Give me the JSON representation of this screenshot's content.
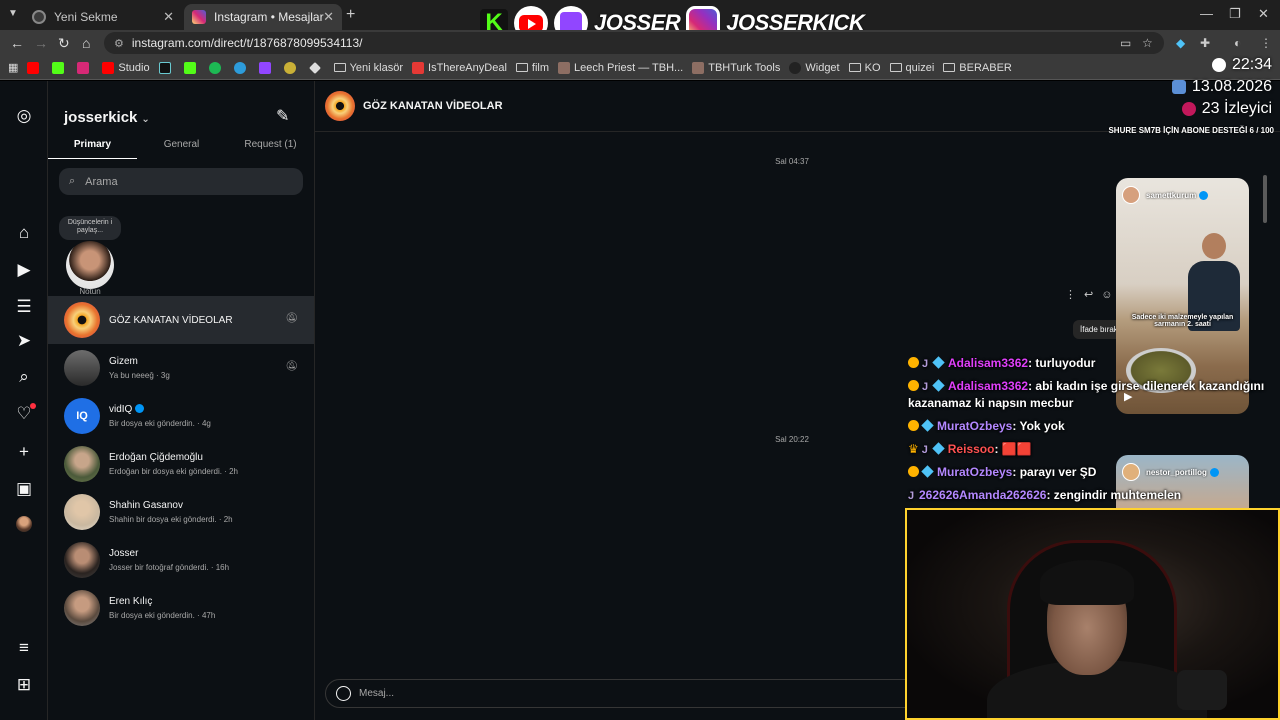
{
  "browser": {
    "tabs": [
      {
        "label": "Yeni Sekme",
        "active": false,
        "favicon_color": "#3b3b3b"
      },
      {
        "label": "Instagram • Mesajlar",
        "active": true,
        "favicon_color": "#e1306c"
      }
    ],
    "url": "instagram.com/direct/t/1876878099534113/",
    "bookmarks": [
      "Studio",
      "Yeni klasör",
      "IsThereAnyDeal",
      "film",
      "Leech Priest — TBH...",
      "TBHTurk Tools",
      "Widget",
      "KO",
      "quizei",
      "BERABER"
    ]
  },
  "stream_banner": {
    "name1": "JOSSER",
    "name2": "JOSSERKICK"
  },
  "overlay": {
    "time": "22:34",
    "date": "13.08.2026",
    "viewers": "23 İzleyici",
    "sub_goal": "SHURE SM7B İÇİN ABONE DESTEĞİ 6 / 100"
  },
  "instagram": {
    "username": "josserkick",
    "tabs": [
      "Primary",
      "General",
      "Request (1)"
    ],
    "search_placeholder": "Arama",
    "note_bubble": "Düşüncelerin i paylaş...",
    "note_label": "Notun",
    "conversations": [
      {
        "name": "GÖZ KANATAN VİDEOLAR",
        "sub": "",
        "muted": true,
        "selected": true
      },
      {
        "name": "Gizem",
        "sub": "Ya bu neeeğ · 3g",
        "muted": true,
        "selected": false
      },
      {
        "name": "vidIQ",
        "sub": "Bir dosya eki gönderdin. · 4g",
        "muted": false,
        "verified": true,
        "selected": false
      },
      {
        "name": "Erdoğan Çiğdemoğlu",
        "sub": "Erdoğan bir dosya eki gönderdi. · 2h",
        "muted": false,
        "selected": false
      },
      {
        "name": "Shahin Gasanov",
        "sub": "Shahin bir dosya eki gönderdi. · 2h",
        "muted": false,
        "selected": false
      },
      {
        "name": "Josser",
        "sub": "Josser bir fotoğraf gönderdi. · 16h",
        "muted": false,
        "selected": false
      },
      {
        "name": "Eren Kılıç",
        "sub": "Bir dosya eki gönderdin. · 47h",
        "muted": false,
        "selected": false
      }
    ],
    "chat": {
      "title": "GÖZ KANATAN VİDEOLAR",
      "timestamps": [
        "Sal 04:37",
        "Sal 20:22"
      ],
      "tooltip": "İfade bırak",
      "reel1": {
        "user": "samettkurum",
        "caption": "Sadece iki malzemeyle yapılan sarmanın 2. saati"
      },
      "reel2": {
        "user": "nestor_portillog"
      },
      "composer_placeholder": "Mesaj..."
    }
  },
  "stream_chat": [
    {
      "user": "Adalisam3362",
      "color": "#e040fb",
      "text": "turluyodur"
    },
    {
      "user": "Adalisam3362",
      "color": "#e040fb",
      "text": "abi kadın işe girse dilenerek kazandığını kazanamaz ki napsın mecbur"
    },
    {
      "user": "MuratOzbeys",
      "color": "#b388ff",
      "text": "Yok yok"
    },
    {
      "user": "Reissoo",
      "color": "#ff5252",
      "text": "🟥🟥"
    },
    {
      "user": "MuratOzbeys",
      "color": "#b388ff",
      "text": "parayı ver ŞD"
    },
    {
      "user": "262626Amanda262626",
      "color": "#b388ff",
      "text": "zengindir muhtemelen"
    }
  ]
}
